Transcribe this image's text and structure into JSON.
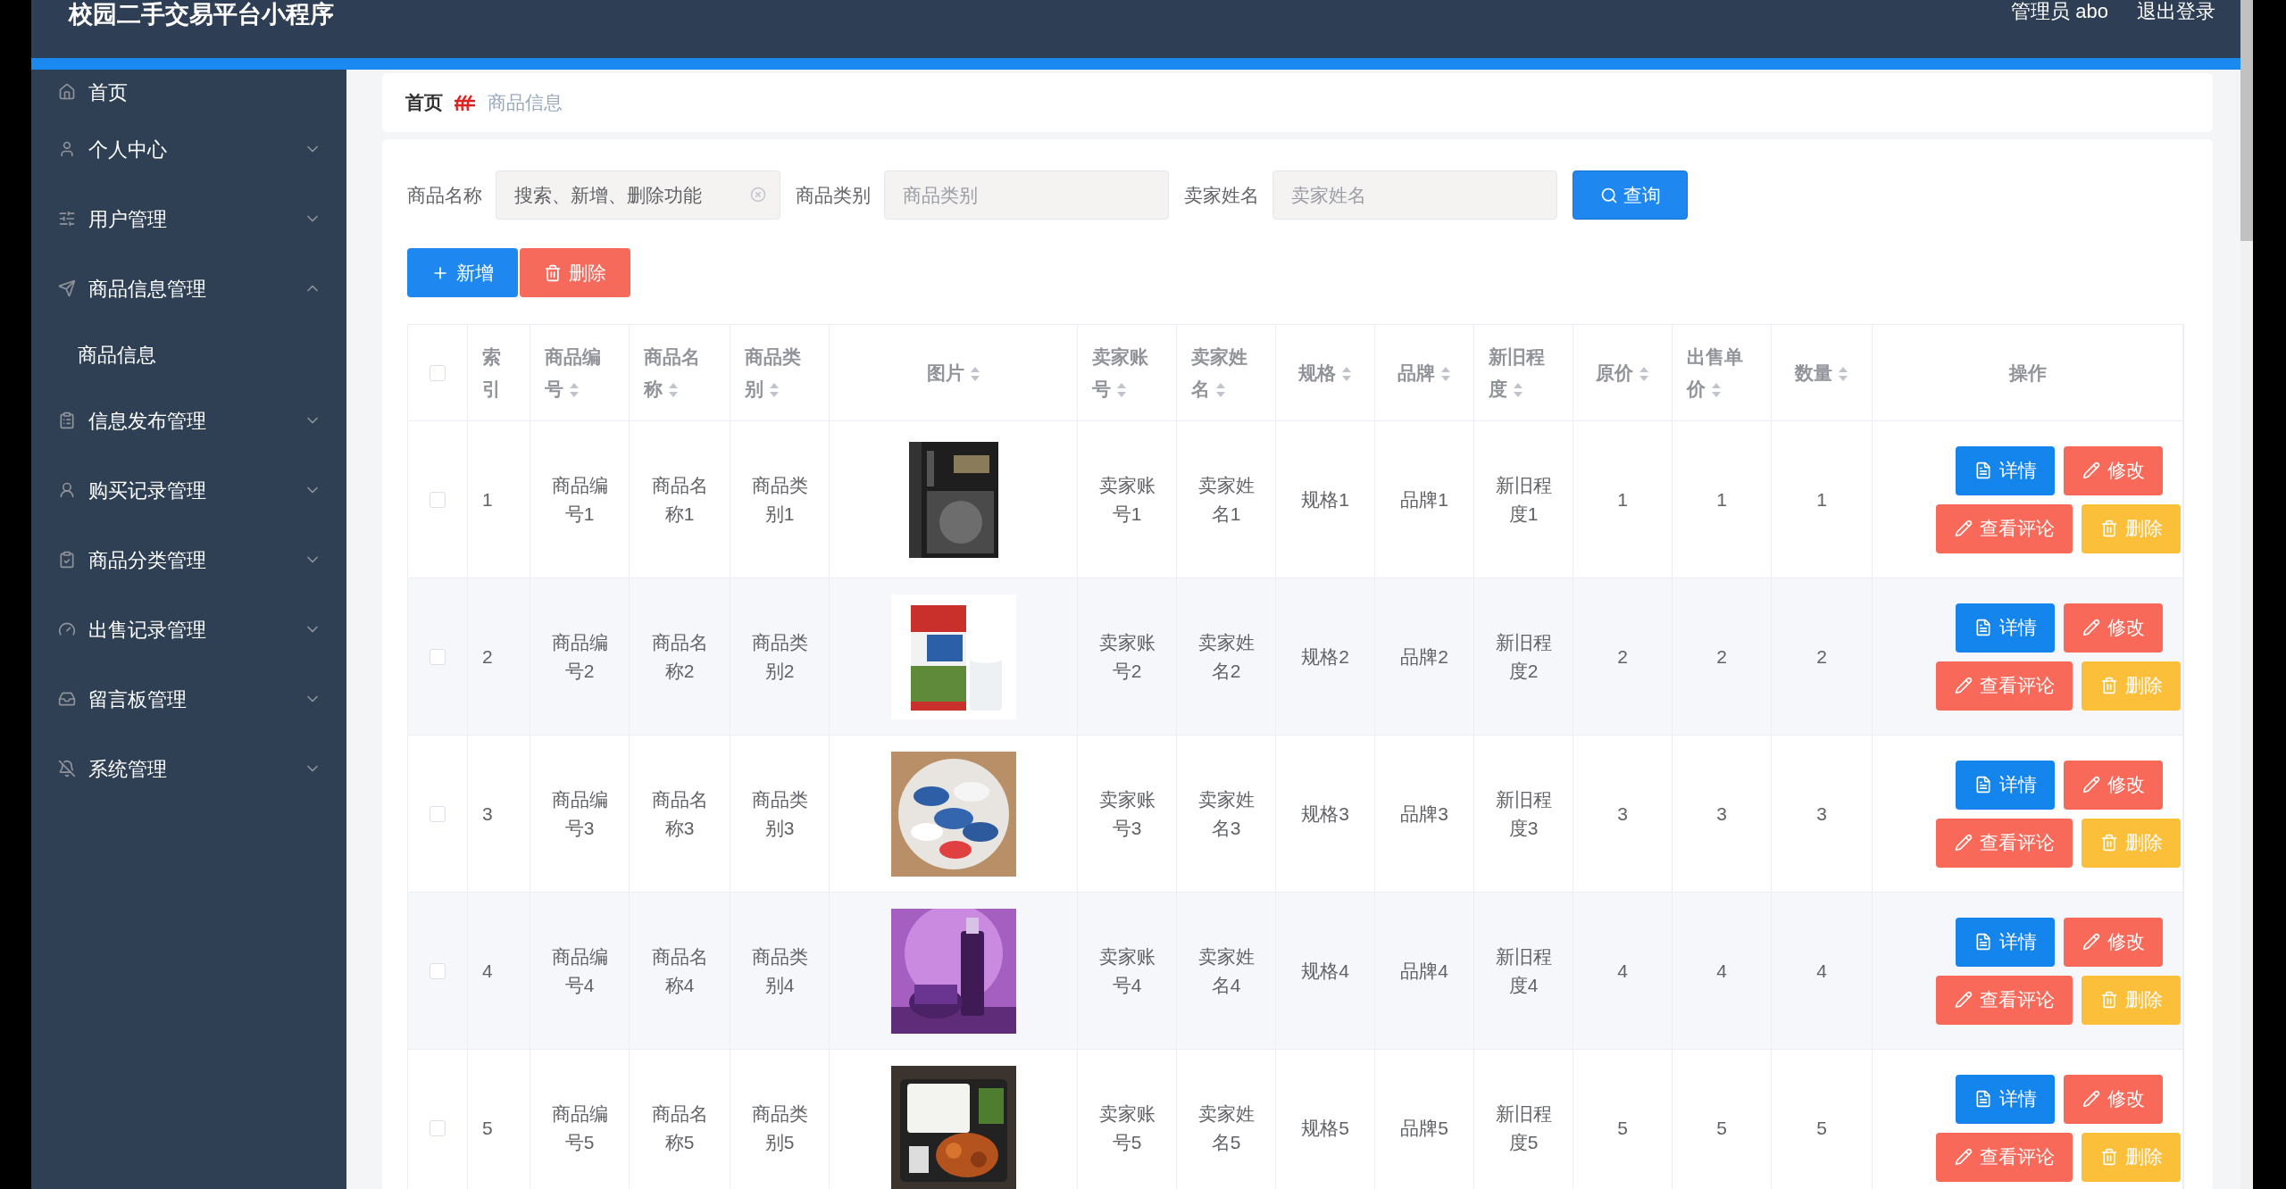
{
  "header": {
    "title": "校园二手交易平台小程序",
    "user": "管理员 abo",
    "logout": "退出登录"
  },
  "sidebar": {
    "items": [
      {
        "label": "首页"
      },
      {
        "label": "个人中心",
        "expanded": false
      },
      {
        "label": "用户管理",
        "expanded": false
      },
      {
        "label": "商品信息管理",
        "expanded": true,
        "children": [
          {
            "label": "商品信息"
          }
        ]
      },
      {
        "label": "信息发布管理",
        "expanded": false
      },
      {
        "label": "购买记录管理",
        "expanded": false
      },
      {
        "label": "商品分类管理",
        "expanded": false
      },
      {
        "label": "出售记录管理",
        "expanded": false
      },
      {
        "label": "留言板管理",
        "expanded": false
      },
      {
        "label": "系统管理",
        "expanded": false
      }
    ]
  },
  "breadcrumb": [
    "首页",
    "商品信息"
  ],
  "search": {
    "fields": [
      {
        "label": "商品名称",
        "value": "搜索、新增、删除功能"
      },
      {
        "label": "商品类别",
        "placeholder": "商品类别"
      },
      {
        "label": "卖家姓名",
        "placeholder": "卖家姓名"
      }
    ],
    "button": "查询"
  },
  "toolbar": [
    {
      "label": "新增",
      "kind": "add"
    },
    {
      "label": "删除",
      "kind": "delete"
    }
  ],
  "table": {
    "select_all": {
      "checked": false
    },
    "columns": [
      {
        "label": "索引",
        "kind": "text",
        "sortable": false
      },
      {
        "label": "商品编号",
        "kind": "text",
        "sortable": true
      },
      {
        "label": "商品名称",
        "kind": "text",
        "sortable": true
      },
      {
        "label": "商品类别",
        "kind": "text",
        "sortable": true
      },
      {
        "label": "图片",
        "kind": "picture",
        "sortable": true
      },
      {
        "label": "卖家账号",
        "kind": "text",
        "sortable": true
      },
      {
        "label": "卖家姓名",
        "kind": "text",
        "sortable": true
      },
      {
        "label": "规格",
        "kind": "text",
        "sortable": true
      },
      {
        "label": "品牌",
        "kind": "text",
        "sortable": true
      },
      {
        "label": "新旧程度",
        "kind": "text",
        "sortable": true
      },
      {
        "label": "原价",
        "kind": "text",
        "sortable": true
      },
      {
        "label": "出售单价",
        "kind": "text",
        "sortable": true
      },
      {
        "label": "数量",
        "kind": "text",
        "sortable": true
      },
      {
        "label": "操作",
        "kind": "actions",
        "sortable": false
      }
    ],
    "rows": [
      {
        "checked": false,
        "cells": [
          "1",
          "商品编号1",
          "商品名称1",
          "商品类别1",
          {
            "kind": "picture"
          },
          "卖家账号1",
          "卖家姓名1",
          "规格1",
          "品牌1",
          "新旧程度1",
          "1",
          "1",
          "1"
        ],
        "actions": [
          {
            "label": "详情",
            "kind": "detail"
          },
          {
            "label": "修改",
            "kind": "edit"
          },
          {
            "label": "查看评论",
            "kind": "comment"
          },
          {
            "label": "删除",
            "kind": "delete"
          }
        ]
      },
      {
        "checked": false,
        "cells": [
          "2",
          "商品编号2",
          "商品名称2",
          "商品类别2",
          {
            "kind": "picture"
          },
          "卖家账号2",
          "卖家姓名2",
          "规格2",
          "品牌2",
          "新旧程度2",
          "2",
          "2",
          "2"
        ],
        "actions": [
          {
            "label": "详情",
            "kind": "detail"
          },
          {
            "label": "修改",
            "kind": "edit"
          },
          {
            "label": "查看评论",
            "kind": "comment"
          },
          {
            "label": "删除",
            "kind": "delete"
          }
        ]
      },
      {
        "checked": false,
        "cells": [
          "3",
          "商品编号3",
          "商品名称3",
          "商品类别3",
          {
            "kind": "picture"
          },
          "卖家账号3",
          "卖家姓名3",
          "规格3",
          "品牌3",
          "新旧程度3",
          "3",
          "3",
          "3"
        ],
        "actions": [
          {
            "label": "详情",
            "kind": "detail"
          },
          {
            "label": "修改",
            "kind": "edit"
          },
          {
            "label": "查看评论",
            "kind": "comment"
          },
          {
            "label": "删除",
            "kind": "delete"
          }
        ]
      },
      {
        "checked": false,
        "cells": [
          "4",
          "商品编号4",
          "商品名称4",
          "商品类别4",
          {
            "kind": "picture"
          },
          "卖家账号4",
          "卖家姓名4",
          "规格4",
          "品牌4",
          "新旧程度4",
          "4",
          "4",
          "4"
        ],
        "actions": [
          {
            "label": "详情",
            "kind": "detail"
          },
          {
            "label": "修改",
            "kind": "edit"
          },
          {
            "label": "查看评论",
            "kind": "comment"
          },
          {
            "label": "删除",
            "kind": "delete"
          }
        ]
      },
      {
        "checked": false,
        "cells": [
          "5",
          "商品编号5",
          "商品名称5",
          "商品类别5",
          {
            "kind": "picture"
          },
          "卖家账号5",
          "卖家姓名5",
          "规格5",
          "品牌5",
          "新旧程度5",
          "5",
          "5",
          "5"
        ],
        "actions": [
          {
            "label": "详情",
            "kind": "detail"
          },
          {
            "label": "修改",
            "kind": "edit"
          },
          {
            "label": "查看评论",
            "kind": "comment"
          },
          {
            "label": "删除",
            "kind": "delete"
          }
        ]
      }
    ]
  }
}
